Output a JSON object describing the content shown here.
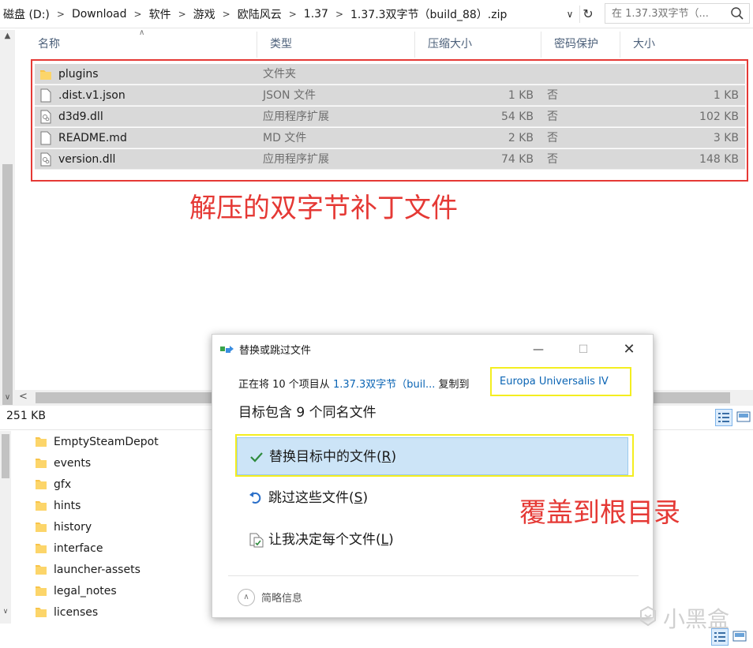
{
  "address_bar": {
    "breadcrumb": [
      "磁盘 (D:)",
      "Download",
      "软件",
      "游戏",
      "欧陆风云",
      "1.37",
      "1.37.3双字节（build_88）.zip"
    ],
    "search_placeholder": "在 1.37.3双字节（..."
  },
  "columns": {
    "name": "名称",
    "type": "类型",
    "compressed_size": "压缩大小",
    "password": "密码保护",
    "size": "大小"
  },
  "files": [
    {
      "name": "plugins",
      "type": "文件夹",
      "compressed_size": "",
      "password": "",
      "size": "",
      "icon": "folder-icon"
    },
    {
      "name": ".dist.v1.json",
      "type": "JSON 文件",
      "compressed_size": "1 KB",
      "password": "否",
      "size": "1 KB",
      "icon": "file-icon"
    },
    {
      "name": "d3d9.dll",
      "type": "应用程序扩展",
      "compressed_size": "54 KB",
      "password": "否",
      "size": "102 KB",
      "icon": "dll-file-icon"
    },
    {
      "name": "README.md",
      "type": "MD 文件",
      "compressed_size": "2 KB",
      "password": "否",
      "size": "3 KB",
      "icon": "file-icon"
    },
    {
      "name": "version.dll",
      "type": "应用程序扩展",
      "compressed_size": "74 KB",
      "password": "否",
      "size": "148 KB",
      "icon": "dll-file-icon"
    }
  ],
  "annotations": {
    "extracted_note": "解压的双字节补丁文件",
    "overwrite_note": "覆盖到根目录"
  },
  "status": {
    "size_text": "251 KB"
  },
  "lower_folders": [
    "EmptySteamDepot",
    "events",
    "gfx",
    "hints",
    "history",
    "interface",
    "launcher-assets",
    "legal_notes",
    "licenses"
  ],
  "dialog": {
    "title": "替换或跳过文件",
    "copy_prefix": "正在将 10 个项目从 ",
    "copy_source": "1.37.3双字节（buil...",
    "copy_middle": " 复制到 ",
    "copy_dest": "Europa Universalis IV",
    "heading": "目标包含 9 个同名文件",
    "options": [
      {
        "label": "替换目标中的文件",
        "hotkey_open": "(",
        "hotkey": "R",
        "hotkey_close": ")"
      },
      {
        "label": "跳过这些文件",
        "hotkey_open": "(",
        "hotkey": "S",
        "hotkey_close": ")"
      },
      {
        "label": "让我决定每个文件",
        "hotkey_open": "(",
        "hotkey": "L",
        "hotkey_close": ")"
      }
    ],
    "details_label": "简略信息"
  },
  "watermark": "小黑盒",
  "colors": {
    "selection": "#d9d9d9",
    "annotation_red": "#e53935",
    "highlight_yellow": "#f4ee20",
    "link_blue": "#0a64b4",
    "option_selected": "#cce4f7"
  }
}
